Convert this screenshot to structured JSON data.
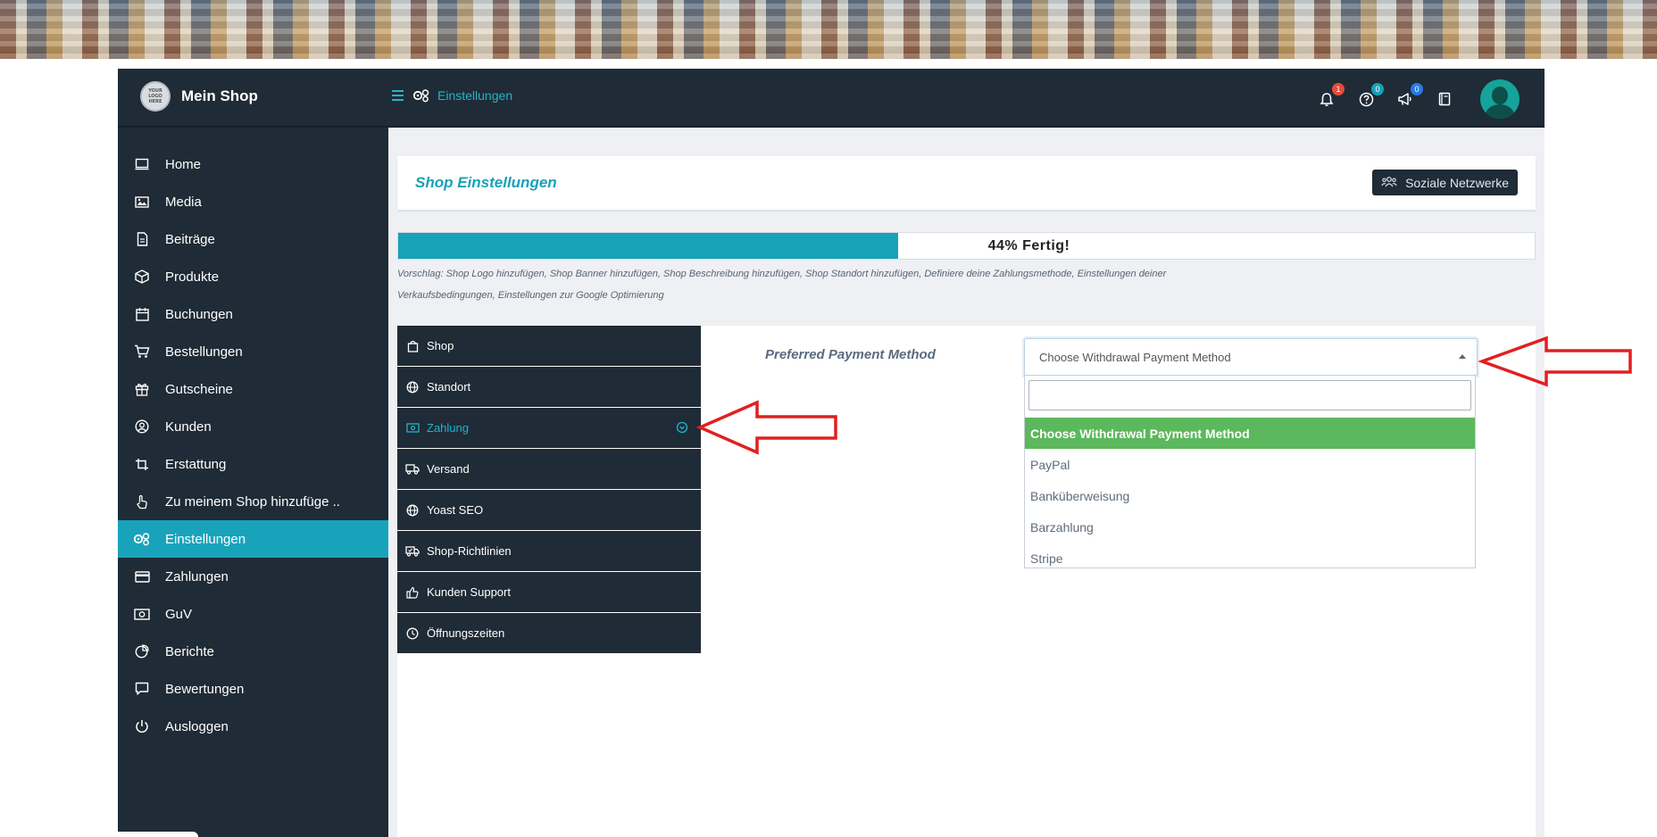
{
  "brand": {
    "logo_text": "YOUR LOGO HERE",
    "name": "Mein Shop"
  },
  "breadcrumb": {
    "label": "Einstellungen"
  },
  "notifications": {
    "bell_count": "1",
    "help_count": "0",
    "announce_count": "0"
  },
  "sidebar": {
    "items": [
      {
        "label": "Home",
        "icon": "monitor-icon"
      },
      {
        "label": "Media",
        "icon": "image-icon"
      },
      {
        "label": "Beiträge",
        "icon": "document-icon"
      },
      {
        "label": "Produkte",
        "icon": "box-icon"
      },
      {
        "label": "Buchungen",
        "icon": "calendar-icon"
      },
      {
        "label": "Bestellungen",
        "icon": "cart-icon"
      },
      {
        "label": "Gutscheine",
        "icon": "gift-icon"
      },
      {
        "label": "Kunden",
        "icon": "user-circle-icon"
      },
      {
        "label": "Erstattung",
        "icon": "crop-icon"
      },
      {
        "label": "Zu meinem Shop hinzufüge ..",
        "icon": "hand-pointer-icon"
      },
      {
        "label": "Einstellungen",
        "icon": "gears-icon",
        "active": true
      },
      {
        "label": "Zahlungen",
        "icon": "credit-card-icon"
      },
      {
        "label": "GuV",
        "icon": "money-icon"
      },
      {
        "label": "Berichte",
        "icon": "pie-chart-icon"
      },
      {
        "label": "Bewertungen",
        "icon": "comment-icon"
      },
      {
        "label": "Ausloggen",
        "icon": "power-icon"
      }
    ]
  },
  "header": {
    "title": "Shop Einstellungen",
    "social_button": "Soziale Netzwerke"
  },
  "progress": {
    "percent": 44,
    "label": "44% Fertig!"
  },
  "suggestion": "Vorschlag: Shop Logo hinzufügen, Shop Banner hinzufügen, Shop Beschreibung hinzufügen, Shop Standort hinzufügen, Definiere deine Zahlungsmethode, Einstellungen deiner Verkaufsbedingungen, Einstellungen zur Google Optimierung",
  "tabs": [
    {
      "label": "Shop",
      "icon": "shopping-bag-icon"
    },
    {
      "label": "Standort",
      "icon": "globe-icon"
    },
    {
      "label": "Zahlung",
      "icon": "money-icon",
      "active": true
    },
    {
      "label": "Versand",
      "icon": "truck-icon"
    },
    {
      "label": "Yoast SEO",
      "icon": "globe-icon"
    },
    {
      "label": "Shop-Richtlinien",
      "icon": "shipping-policy-icon"
    },
    {
      "label": "Kunden Support",
      "icon": "thumbs-up-icon"
    },
    {
      "label": "Öffnungszeiten",
      "icon": "clock-icon"
    }
  ],
  "payment": {
    "label": "Preferred Payment Method",
    "selected": "Choose Withdrawal Payment Method",
    "search_value": "",
    "options": [
      "Choose Withdrawal Payment Method",
      "PayPal",
      "Banküberweisung",
      "Barzahlung",
      "Stripe"
    ]
  },
  "colors": {
    "dark": "#1f2b36",
    "accent": "#19a3bb",
    "selected_option": "#5cb85c",
    "annotation": "#e02020"
  }
}
